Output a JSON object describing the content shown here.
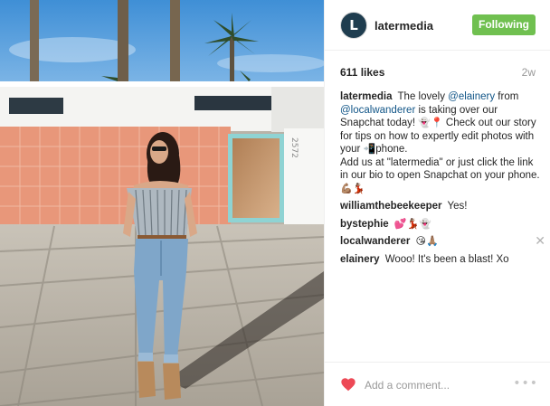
{
  "post": {
    "photo_alt": "Woman in striped off-shoulder top and jeans standing in front of a peach wall with palm trees",
    "house_number": "2572"
  },
  "header": {
    "avatar_letter": "L",
    "username": "latermedia",
    "follow_label": "Following",
    "follow_color": "#70c050"
  },
  "stats": {
    "likes": "611 likes",
    "age": "2w"
  },
  "caption": {
    "user": "latermedia",
    "text_1": "The lovely ",
    "mention_1": "@elainery",
    "text_2": " from ",
    "mention_2": "@localwanderer",
    "text_3": " is taking over our Snapchat today! ",
    "emoji_1": "👻📍",
    "text_4": " Check out our story for tips on how to expertly edit photos with your ",
    "emoji_2": "📲",
    "text_5": "phone.",
    "text_6": "Add us at \"latermedia\" or just click the link in our bio to open Snapchat on your phone.",
    "emoji_3": "💪🏽💃🏽"
  },
  "comments": [
    {
      "user": "williamthebeekeeper",
      "text": "Yes!"
    },
    {
      "user": "bystephie",
      "text": "",
      "emoji": "💕💃🏽👻"
    },
    {
      "user": "localwanderer",
      "text": "",
      "emoji": "😘🙏🏽",
      "close": "✕"
    },
    {
      "user": "elainery",
      "text": "Wooo! It's been a blast! Xo"
    }
  ],
  "footer": {
    "add_comment_placeholder": "Add a comment...",
    "more_label": "•••",
    "heart_color": "#ed4956"
  },
  "mention_color": "#125688"
}
